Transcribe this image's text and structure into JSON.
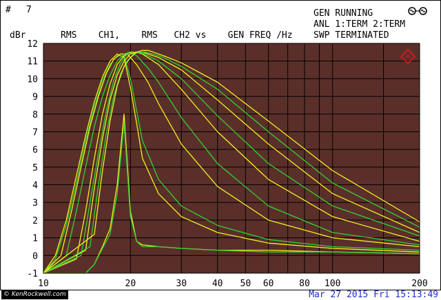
{
  "header": {
    "hash_sign": "#",
    "screen_number": "7",
    "y_unit": "dBr",
    "trace_description": "RMS    CH1,    RMS   CH2 vs    GEN FREQ /Hz",
    "status_lines": [
      "GEN RUNNING",
      "ANL 1:TERM 2:TERM",
      "SWP TERMINATED"
    ]
  },
  "footer": {
    "watermark": "© KenRockwell.com",
    "timestamp": "Mar 27 2015 Fri 15:13:49"
  },
  "colors": {
    "plot_background": "#5a2f2a",
    "grid": "#000000",
    "trace_yellow": "#f2f21e",
    "trace_green": "#32d232",
    "timestamp": "#1e2bd2",
    "marker": "#e8141e"
  },
  "icons": [
    "generator-symbol-icon",
    "rs-logo-icon"
  ],
  "chart_data": {
    "type": "line",
    "title": "",
    "xlabel": "GEN FREQ /Hz",
    "ylabel": "dBr",
    "x_scale": "log",
    "xlim": [
      10,
      200
    ],
    "ylim": [
      -1,
      12
    ],
    "x_ticks": [
      10,
      20,
      30,
      40,
      50,
      60,
      80,
      100,
      200
    ],
    "y_ticks": [
      -1,
      0,
      1,
      2,
      3,
      4,
      5,
      6,
      7,
      8,
      9,
      10,
      11,
      12
    ],
    "grid": true,
    "legend": "none",
    "series": [
      {
        "color": "yellow",
        "x": [
          10,
          14,
          15,
          16,
          17,
          18,
          19,
          20,
          21,
          22,
          25,
          30,
          40,
          60,
          100,
          200
        ],
        "y": [
          -1,
          -1,
          -0.5,
          0.5,
          1.5,
          4,
          8,
          2.5,
          0.8,
          0.6,
          0.5,
          0.4,
          0.3,
          0.3,
          0.2,
          0.1
        ]
      },
      {
        "color": "green",
        "x": [
          10,
          14,
          15,
          16,
          17,
          18,
          19,
          20,
          21,
          22,
          25,
          30,
          40,
          60,
          100,
          200
        ],
        "y": [
          -1,
          -1,
          -0.5,
          0.4,
          1.2,
          3.5,
          7.5,
          2.2,
          0.8,
          0.5,
          0.5,
          0.4,
          0.3,
          0.2,
          0.2,
          0.1
        ]
      },
      {
        "color": "yellow",
        "x": [
          10,
          11,
          12,
          13,
          14,
          15,
          16,
          17,
          18,
          19,
          20,
          21,
          22,
          25,
          30,
          40,
          60,
          100,
          200
        ],
        "y": [
          -1,
          0,
          2,
          4.5,
          6.8,
          8.7,
          10.1,
          11.0,
          11.4,
          11.2,
          9.5,
          7.5,
          5.5,
          3.5,
          2.2,
          1.3,
          0.7,
          0.4,
          0.2
        ]
      },
      {
        "color": "green",
        "x": [
          10,
          11,
          12,
          13,
          14,
          15,
          16,
          17,
          18,
          19,
          20,
          21,
          22,
          25,
          30,
          40,
          60,
          100,
          200
        ],
        "y": [
          -1,
          -0.2,
          1.7,
          4.1,
          6.5,
          8.4,
          9.9,
          10.8,
          11.3,
          11.3,
          10,
          8.2,
          6.5,
          4.3,
          2.8,
          1.7,
          0.9,
          0.5,
          0.3
        ]
      },
      {
        "color": "yellow",
        "x": [
          10,
          11.5,
          12.5,
          13.5,
          14.5,
          15.5,
          16.5,
          17.5,
          18.5,
          19.5,
          21,
          23,
          25,
          30,
          40,
          60,
          100,
          200
        ],
        "y": [
          -1,
          0,
          2.5,
          5,
          7.3,
          9,
          10.3,
          11.1,
          11.4,
          11.4,
          10.8,
          9.8,
          8.6,
          6.3,
          3.9,
          2,
          1,
          0.5
        ]
      },
      {
        "color": "green",
        "x": [
          10,
          12,
          13,
          14,
          15,
          16,
          17,
          18,
          19,
          20,
          21,
          23,
          25,
          30,
          40,
          60,
          100,
          200
        ],
        "y": [
          -1,
          0,
          2.5,
          5,
          7.3,
          9,
          10.2,
          11,
          11.4,
          11.5,
          11.3,
          10.6,
          9.8,
          7.8,
          5.2,
          2.8,
          1.3,
          0.6
        ]
      },
      {
        "color": "yellow",
        "x": [
          10,
          13,
          14,
          15,
          16,
          17,
          18,
          19,
          20,
          21,
          22,
          25,
          30,
          40,
          60,
          100,
          200
        ],
        "y": [
          -1,
          -0.2,
          2.5,
          5.5,
          8,
          9.7,
          10.8,
          11.3,
          11.5,
          11.5,
          11.4,
          10.8,
          9.4,
          7,
          4.3,
          2.2,
          0.8
        ]
      },
      {
        "color": "green",
        "x": [
          10,
          13.5,
          14.5,
          15.5,
          16.5,
          17.5,
          18.5,
          19.5,
          20.5,
          21.5,
          23,
          25,
          30,
          40,
          60,
          100,
          200
        ],
        "y": [
          -1,
          0,
          3,
          5.8,
          8.2,
          9.9,
          10.9,
          11.4,
          11.5,
          11.5,
          11.3,
          11,
          10,
          7.9,
          5.2,
          2.8,
          1.1
        ]
      },
      {
        "color": "yellow",
        "x": [
          10,
          14,
          15,
          16,
          17,
          18,
          19,
          20,
          21,
          22,
          23,
          25,
          30,
          40,
          60,
          100,
          200
        ],
        "y": [
          -1,
          0.3,
          3.8,
          6.6,
          8.8,
          10.2,
          11,
          11.4,
          11.5,
          11.5,
          11.4,
          11.2,
          10.5,
          8.8,
          6.3,
          3.5,
          1.3
        ]
      },
      {
        "color": "green",
        "x": [
          10,
          14.5,
          15.5,
          16.5,
          17.5,
          18.5,
          19.5,
          20.5,
          21.5,
          22.5,
          24,
          26,
          30,
          40,
          60,
          100,
          200
        ],
        "y": [
          -1,
          0.5,
          4,
          6.9,
          9,
          10.3,
          11,
          11.4,
          11.5,
          11.5,
          11.4,
          11.2,
          10.7,
          9.4,
          7,
          4.1,
          1.6
        ]
      },
      {
        "color": "yellow",
        "x": [
          10,
          15,
          16,
          17,
          18,
          19,
          20,
          21,
          22,
          23,
          24,
          26,
          30,
          40,
          60,
          100,
          200
        ],
        "y": [
          -1,
          1.2,
          4.8,
          7.6,
          9.6,
          10.7,
          11.2,
          11.5,
          11.6,
          11.6,
          11.5,
          11.3,
          10.9,
          9.8,
          7.6,
          4.8,
          1.9
        ]
      }
    ]
  }
}
